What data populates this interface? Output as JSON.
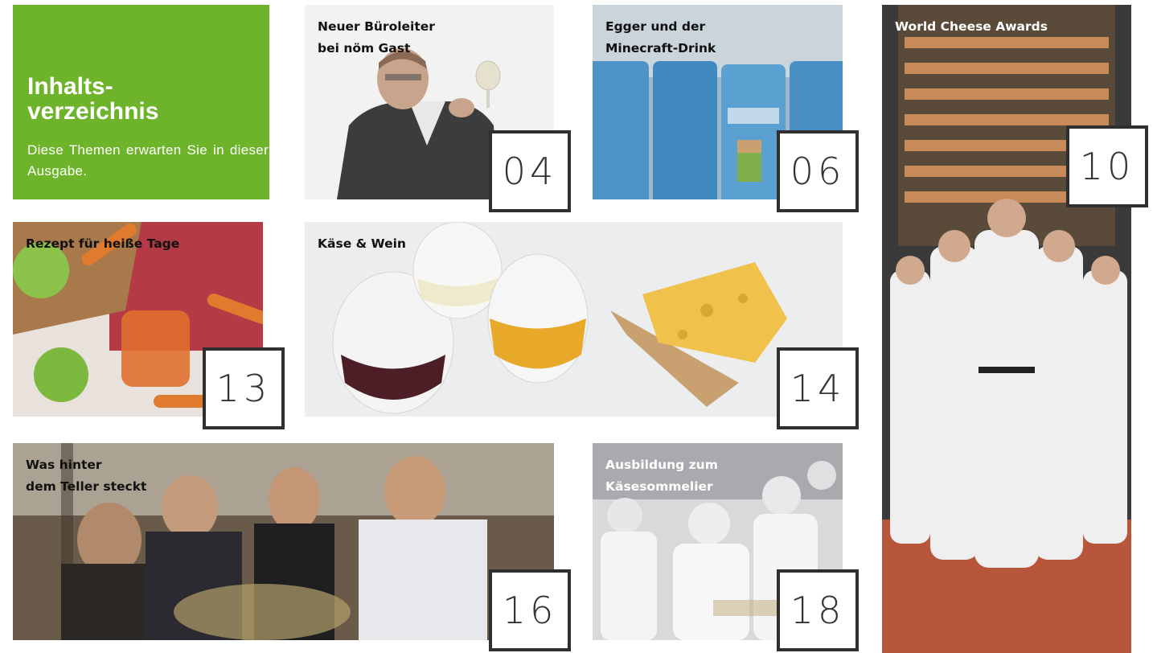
{
  "toc": {
    "title_line1": "Inhalts-",
    "title_line2": "verzeichnis",
    "subtitle": "Diese Themen erwarten Sie in dieser Ausgabe."
  },
  "articles": [
    {
      "caption": "Neuer Büroleiter\nbei nöm Gast",
      "page": "04"
    },
    {
      "caption": "Egger und der\nMinecraft-Drink",
      "page": "06"
    },
    {
      "caption": "World Cheese Awards",
      "page": "10"
    },
    {
      "caption": "Rezept für heiße Tage",
      "page": "13"
    },
    {
      "caption": "Käse & Wein",
      "page": "14"
    },
    {
      "caption": "Was hinter\ndem Teller steckt",
      "page": "16"
    },
    {
      "caption": "Ausbildung zum\nKäsesommelier",
      "page": "18"
    }
  ],
  "colors": {
    "accent_green": "#6db42a",
    "box_border": "#2f2f2f"
  }
}
